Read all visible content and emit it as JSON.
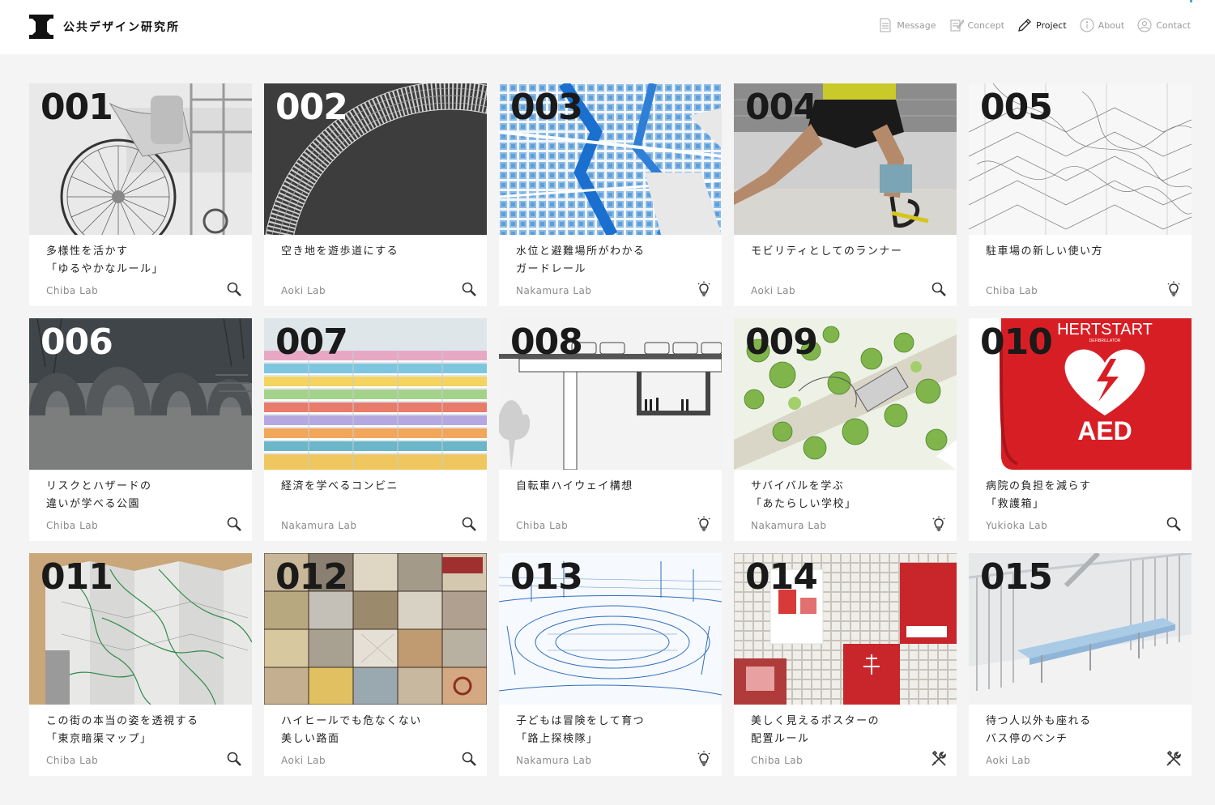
{
  "site": {
    "name": "公共デザイン研究所",
    "logo_icon": "seal-logo-icon"
  },
  "nav": [
    {
      "label": "Message",
      "icon": "document-icon",
      "active": false
    },
    {
      "label": "Concept",
      "icon": "notepad-icon",
      "active": false
    },
    {
      "label": "Project",
      "icon": "pencil-icon",
      "active": true
    },
    {
      "label": "About",
      "icon": "info-icon",
      "active": false
    },
    {
      "label": "Contact",
      "icon": "user-icon",
      "active": false
    }
  ],
  "colors": {
    "accent": "#4aa3df",
    "background": "#f4f4f4",
    "card": "#ffffff",
    "aed_red": "#d81e25"
  },
  "projects": [
    {
      "number": "001",
      "title": "多様性を活かす\n「ゆるやかなルール」",
      "lab": "Chiba Lab",
      "icon": "search-icon"
    },
    {
      "number": "002",
      "title": "空き地を遊歩道にする",
      "lab": "Aoki Lab",
      "icon": "search-icon"
    },
    {
      "number": "003",
      "title": "水位と避難場所がわかる\nガードレール",
      "lab": "Nakamura Lab",
      "icon": "lightbulb-icon"
    },
    {
      "number": "004",
      "title": "モビリティとしてのランナー",
      "lab": "Aoki Lab",
      "icon": "search-icon"
    },
    {
      "number": "005",
      "title": "駐車場の新しい使い方",
      "lab": "Chiba Lab",
      "icon": "lightbulb-icon"
    },
    {
      "number": "006",
      "title": "リスクとハザードの\n違いが学べる公園",
      "lab": "Chiba Lab",
      "icon": "search-icon"
    },
    {
      "number": "007",
      "title": "経済を学べるコンビニ",
      "lab": "Nakamura Lab",
      "icon": "search-icon"
    },
    {
      "number": "008",
      "title": "自転車ハイウェイ構想",
      "lab": "Chiba Lab",
      "icon": "lightbulb-icon"
    },
    {
      "number": "009",
      "title": "サバイバルを学ぶ\n「あたらしい学校」",
      "lab": "Nakamura Lab",
      "icon": "lightbulb-icon"
    },
    {
      "number": "010",
      "title": "病院の負担を減らす\n「救護箱」",
      "lab": "Yukioka Lab",
      "icon": "search-icon"
    },
    {
      "number": "011",
      "title": "この街の本当の姿を透視する\n「東京暗渠マップ」",
      "lab": "Chiba Lab",
      "icon": "search-icon"
    },
    {
      "number": "012",
      "title": "ハイヒールでも危なくない\n美しい路面",
      "lab": "Aoki Lab",
      "icon": "search-icon"
    },
    {
      "number": "013",
      "title": "子どもは冒険をして育つ\n「路上探検隊」",
      "lab": "Nakamura Lab",
      "icon": "lightbulb-icon"
    },
    {
      "number": "014",
      "title": "美しく見えるポスターの\n配置ルール",
      "lab": "Chiba Lab",
      "icon": "tools-icon"
    },
    {
      "number": "015",
      "title": "待つ人以外も座れる\nバス停のベンチ",
      "lab": "Aoki Lab",
      "icon": "tools-icon"
    }
  ],
  "aed_art": {
    "brand": "HERTSTART",
    "sub": "DEFIBRILLATOR",
    "label": "AED"
  }
}
